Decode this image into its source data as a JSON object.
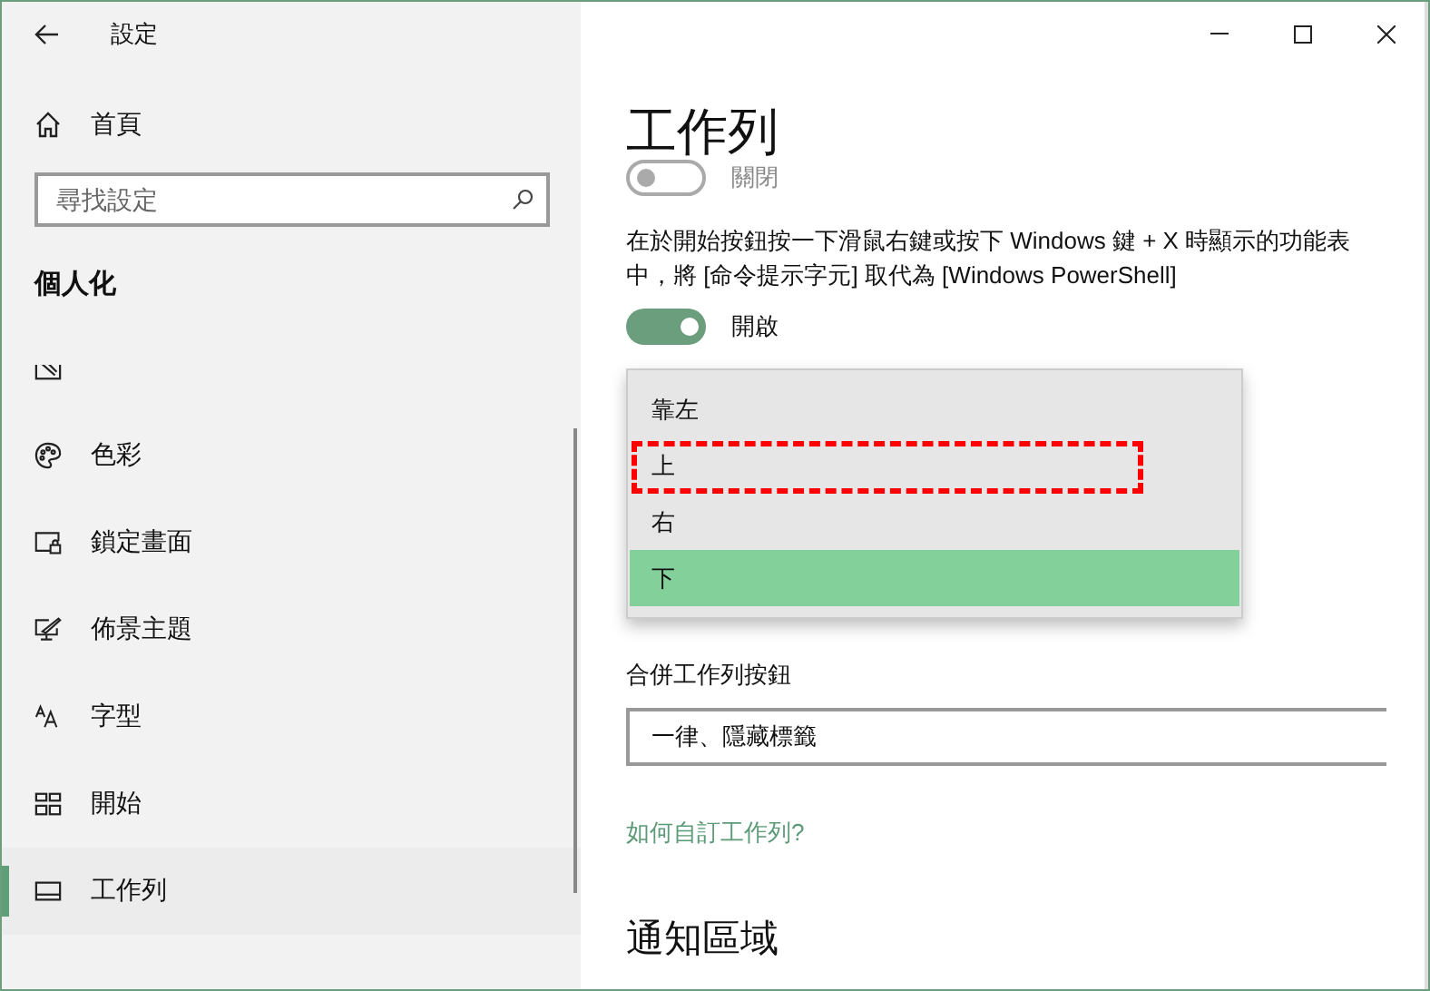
{
  "window": {
    "title": "設定"
  },
  "sidebar": {
    "home": "首頁",
    "search": {
      "placeholder": "尋找設定"
    },
    "section": "個人化",
    "items": [
      {
        "label": "色彩",
        "selected": false
      },
      {
        "label": "鎖定畫面",
        "selected": false
      },
      {
        "label": "佈景主題",
        "selected": false
      },
      {
        "label": "字型",
        "selected": false
      },
      {
        "label": "開始",
        "selected": false
      },
      {
        "label": "工作列",
        "selected": true
      }
    ]
  },
  "content": {
    "title": "工作列",
    "toggle_1": {
      "on": false,
      "label": "關閉"
    },
    "description": "在於開始按鈕按一下滑鼠右鍵或按下 Windows 鍵 + X 時顯示的功能表中，將 [命令提示字元] 取代為 [Windows PowerShell]",
    "toggle_2": {
      "on": true,
      "label": "開啟"
    },
    "dropdown_options": [
      {
        "label": "靠左",
        "selected": false,
        "highlighted": false
      },
      {
        "label": "上",
        "selected": false,
        "highlighted": true
      },
      {
        "label": "右",
        "selected": false,
        "highlighted": false
      },
      {
        "label": "下",
        "selected": true,
        "highlighted": false
      }
    ],
    "combine_label": "合併工作列按鈕",
    "combine_value": "一律、隱藏標籤",
    "link": "如何自訂工作列?",
    "section_title": "通知區域"
  }
}
